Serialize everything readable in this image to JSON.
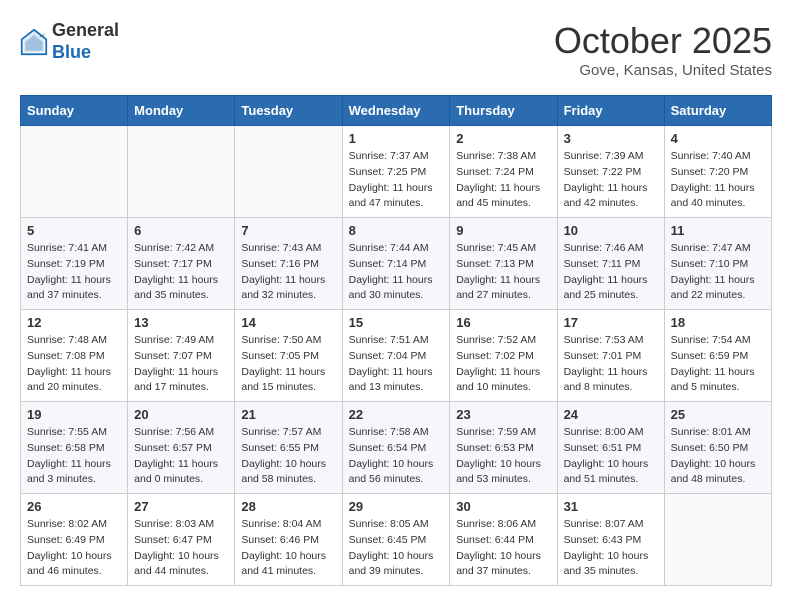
{
  "header": {
    "logo_line1": "General",
    "logo_line2": "Blue",
    "month": "October 2025",
    "location": "Gove, Kansas, United States"
  },
  "weekdays": [
    "Sunday",
    "Monday",
    "Tuesday",
    "Wednesday",
    "Thursday",
    "Friday",
    "Saturday"
  ],
  "weeks": [
    [
      {
        "day": "",
        "info": ""
      },
      {
        "day": "",
        "info": ""
      },
      {
        "day": "",
        "info": ""
      },
      {
        "day": "1",
        "info": "Sunrise: 7:37 AM\nSunset: 7:25 PM\nDaylight: 11 hours and 47 minutes."
      },
      {
        "day": "2",
        "info": "Sunrise: 7:38 AM\nSunset: 7:24 PM\nDaylight: 11 hours and 45 minutes."
      },
      {
        "day": "3",
        "info": "Sunrise: 7:39 AM\nSunset: 7:22 PM\nDaylight: 11 hours and 42 minutes."
      },
      {
        "day": "4",
        "info": "Sunrise: 7:40 AM\nSunset: 7:20 PM\nDaylight: 11 hours and 40 minutes."
      }
    ],
    [
      {
        "day": "5",
        "info": "Sunrise: 7:41 AM\nSunset: 7:19 PM\nDaylight: 11 hours and 37 minutes."
      },
      {
        "day": "6",
        "info": "Sunrise: 7:42 AM\nSunset: 7:17 PM\nDaylight: 11 hours and 35 minutes."
      },
      {
        "day": "7",
        "info": "Sunrise: 7:43 AM\nSunset: 7:16 PM\nDaylight: 11 hours and 32 minutes."
      },
      {
        "day": "8",
        "info": "Sunrise: 7:44 AM\nSunset: 7:14 PM\nDaylight: 11 hours and 30 minutes."
      },
      {
        "day": "9",
        "info": "Sunrise: 7:45 AM\nSunset: 7:13 PM\nDaylight: 11 hours and 27 minutes."
      },
      {
        "day": "10",
        "info": "Sunrise: 7:46 AM\nSunset: 7:11 PM\nDaylight: 11 hours and 25 minutes."
      },
      {
        "day": "11",
        "info": "Sunrise: 7:47 AM\nSunset: 7:10 PM\nDaylight: 11 hours and 22 minutes."
      }
    ],
    [
      {
        "day": "12",
        "info": "Sunrise: 7:48 AM\nSunset: 7:08 PM\nDaylight: 11 hours and 20 minutes."
      },
      {
        "day": "13",
        "info": "Sunrise: 7:49 AM\nSunset: 7:07 PM\nDaylight: 11 hours and 17 minutes."
      },
      {
        "day": "14",
        "info": "Sunrise: 7:50 AM\nSunset: 7:05 PM\nDaylight: 11 hours and 15 minutes."
      },
      {
        "day": "15",
        "info": "Sunrise: 7:51 AM\nSunset: 7:04 PM\nDaylight: 11 hours and 13 minutes."
      },
      {
        "day": "16",
        "info": "Sunrise: 7:52 AM\nSunset: 7:02 PM\nDaylight: 11 hours and 10 minutes."
      },
      {
        "day": "17",
        "info": "Sunrise: 7:53 AM\nSunset: 7:01 PM\nDaylight: 11 hours and 8 minutes."
      },
      {
        "day": "18",
        "info": "Sunrise: 7:54 AM\nSunset: 6:59 PM\nDaylight: 11 hours and 5 minutes."
      }
    ],
    [
      {
        "day": "19",
        "info": "Sunrise: 7:55 AM\nSunset: 6:58 PM\nDaylight: 11 hours and 3 minutes."
      },
      {
        "day": "20",
        "info": "Sunrise: 7:56 AM\nSunset: 6:57 PM\nDaylight: 11 hours and 0 minutes."
      },
      {
        "day": "21",
        "info": "Sunrise: 7:57 AM\nSunset: 6:55 PM\nDaylight: 10 hours and 58 minutes."
      },
      {
        "day": "22",
        "info": "Sunrise: 7:58 AM\nSunset: 6:54 PM\nDaylight: 10 hours and 56 minutes."
      },
      {
        "day": "23",
        "info": "Sunrise: 7:59 AM\nSunset: 6:53 PM\nDaylight: 10 hours and 53 minutes."
      },
      {
        "day": "24",
        "info": "Sunrise: 8:00 AM\nSunset: 6:51 PM\nDaylight: 10 hours and 51 minutes."
      },
      {
        "day": "25",
        "info": "Sunrise: 8:01 AM\nSunset: 6:50 PM\nDaylight: 10 hours and 48 minutes."
      }
    ],
    [
      {
        "day": "26",
        "info": "Sunrise: 8:02 AM\nSunset: 6:49 PM\nDaylight: 10 hours and 46 minutes."
      },
      {
        "day": "27",
        "info": "Sunrise: 8:03 AM\nSunset: 6:47 PM\nDaylight: 10 hours and 44 minutes."
      },
      {
        "day": "28",
        "info": "Sunrise: 8:04 AM\nSunset: 6:46 PM\nDaylight: 10 hours and 41 minutes."
      },
      {
        "day": "29",
        "info": "Sunrise: 8:05 AM\nSunset: 6:45 PM\nDaylight: 10 hours and 39 minutes."
      },
      {
        "day": "30",
        "info": "Sunrise: 8:06 AM\nSunset: 6:44 PM\nDaylight: 10 hours and 37 minutes."
      },
      {
        "day": "31",
        "info": "Sunrise: 8:07 AM\nSunset: 6:43 PM\nDaylight: 10 hours and 35 minutes."
      },
      {
        "day": "",
        "info": ""
      }
    ]
  ]
}
